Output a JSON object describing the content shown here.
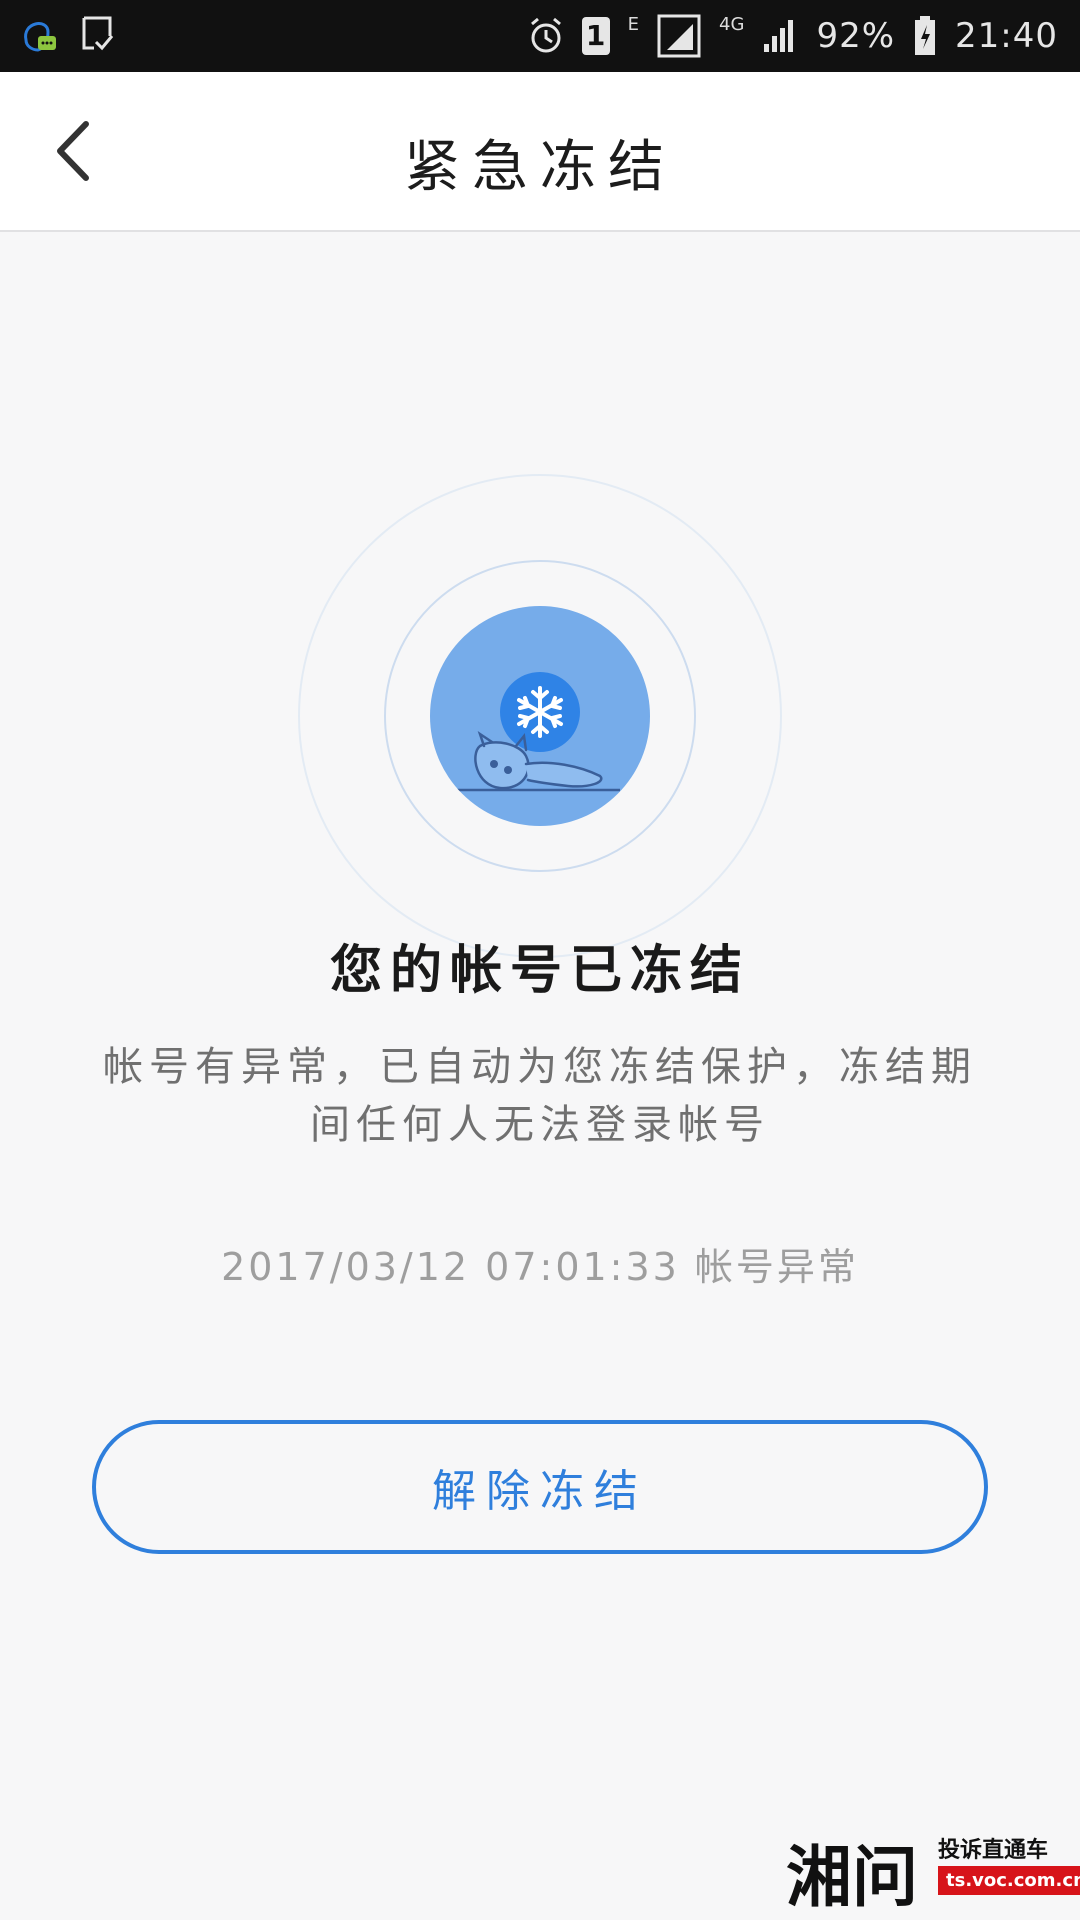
{
  "status_bar": {
    "network_type": "E",
    "lte_label": "4G",
    "sim_number": "1",
    "battery_percent": "92%",
    "time": "21:40",
    "icons": [
      "qq-notification-icon",
      "task-check-icon",
      "alarm-icon",
      "sim-icon",
      "signal-icon",
      "battery-charging-icon"
    ]
  },
  "header": {
    "title": "紧急冻结",
    "back_icon": "chevron-left-icon"
  },
  "freeze_status": {
    "icon": "snowflake-icon",
    "title": "您的帐号已冻结",
    "description": "帐号有异常，已自动为您冻结保护，冻结期间任何人无法登录帐号",
    "timestamp": "2017/03/12 07:01:33 帐号异常",
    "accent_color": "#2f7fdc",
    "disc_color": "#76acea"
  },
  "actions": {
    "unfreeze_label": "解除冻结"
  },
  "watermark": {
    "logo_text": "湘问",
    "slogan": "投诉直通车",
    "url": "ts.voc.com.cn"
  }
}
